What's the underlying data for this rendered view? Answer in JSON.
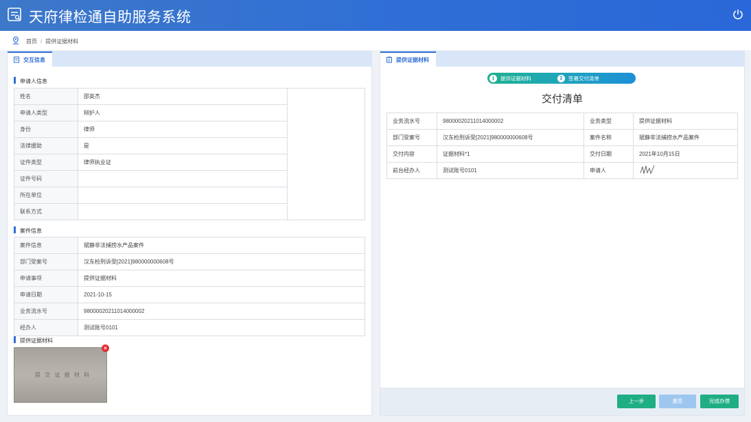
{
  "app": {
    "title": "天府律检通自助服务系统"
  },
  "breadcrumb": {
    "home": "首页",
    "sep": "/",
    "current": "提供证据材料"
  },
  "left_panel": {
    "tab_label": "交互信息",
    "applicant": {
      "section_title": "申请人信息",
      "rows": [
        {
          "label": "姓名",
          "value": "邵英杰"
        },
        {
          "label": "申请人类型",
          "value": "辩护人"
        },
        {
          "label": "身份",
          "value": "律师"
        },
        {
          "label": "法律援助",
          "value": "是"
        },
        {
          "label": "证件类型",
          "value": "律师执业证"
        },
        {
          "label": "证件号码",
          "value": ""
        },
        {
          "label": "所在单位",
          "value": ""
        },
        {
          "label": "联系方式",
          "value": ""
        }
      ]
    },
    "case": {
      "section_title": "案件信息",
      "rows": [
        {
          "label": "案件信息",
          "value": "斌静非法捕捞水产品案件"
        },
        {
          "label": "部门受案号",
          "value": "汉东检刑诉受[2021]980000000608号"
        },
        {
          "label": "申请事项",
          "value": "提供证据材料"
        },
        {
          "label": "申请日期",
          "value": "2021-10-15"
        },
        {
          "label": "业务流水号",
          "value": "98000020211014000002"
        },
        {
          "label": "经办人",
          "value": "测试账号0101"
        }
      ]
    },
    "evidence": {
      "section_title": "提供证据材料",
      "photo_text": "提 交 证 据 材 料",
      "delete_label": "×"
    }
  },
  "right_panel": {
    "tab_label": "提供证据材料",
    "steps": [
      {
        "num": "1",
        "label": "提供证据材料"
      },
      {
        "num": "2",
        "label": "签署交付清单"
      }
    ],
    "doc_title": "交付清单",
    "rows": [
      {
        "k1": "业务流水号",
        "v1": "98000020211014000002",
        "k2": "业务类型",
        "v2": "提供证据材料"
      },
      {
        "k1": "部门受案号",
        "v1": "汉东检刑诉受[2021]980000000608号",
        "k2": "案件名称",
        "v2": "斌静非法捕捞水产品案件"
      },
      {
        "k1": "交付内容",
        "v1": "证据材料*1",
        "k2": "交付日期",
        "v2": "2021年10月15日"
      },
      {
        "k1": "前台经办人",
        "v1": "测试账号0101",
        "k2": "申请人",
        "v2": ""
      }
    ],
    "buttons": {
      "prev": "上一步",
      "reset": "重签",
      "done": "完成办理"
    }
  },
  "colors": {
    "header": "#2f6ed6",
    "accent_green": "#1fae84",
    "reset_btn": "#9ec7ef"
  }
}
